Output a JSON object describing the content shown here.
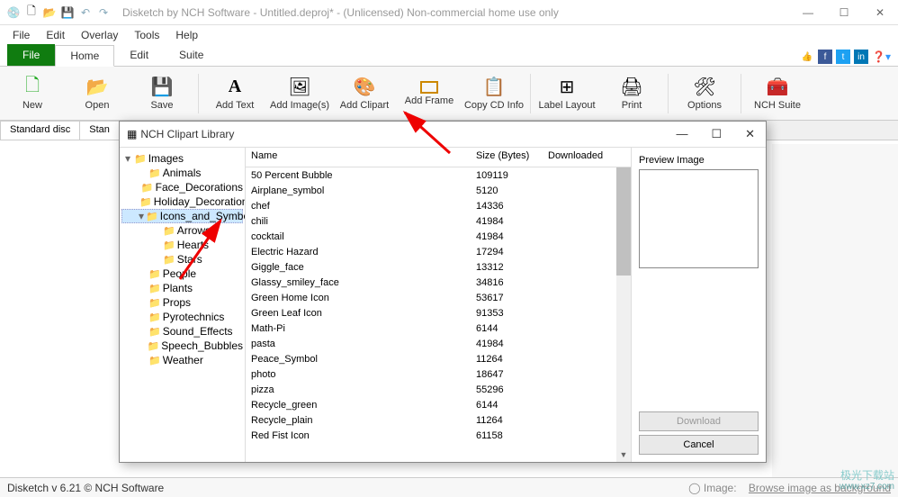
{
  "titlebar": {
    "title": "Disketch by NCH Software - Untitled.deproj* - (Unlicensed) Non-commercial home use only"
  },
  "menubar": [
    "File",
    "Edit",
    "Overlay",
    "Tools",
    "Help"
  ],
  "ribbon": {
    "tabs": [
      "File",
      "Home",
      "Edit",
      "Suite"
    ],
    "active": 1,
    "tools": [
      {
        "label": "New",
        "icon": "🗋"
      },
      {
        "label": "Open",
        "icon": "📂"
      },
      {
        "label": "Save",
        "icon": "💾"
      },
      {
        "label": "Add Text",
        "icon": "A"
      },
      {
        "label": "Add Image(s)",
        "icon": "🖼"
      },
      {
        "label": "Add Clipart",
        "icon": "🎨"
      },
      {
        "label": "Add Frame",
        "icon": "▭"
      },
      {
        "label": "Copy CD Info",
        "icon": "📋"
      },
      {
        "label": "Label Layout",
        "icon": "⊞"
      },
      {
        "label": "Print",
        "icon": "🖨"
      },
      {
        "label": "Options",
        "icon": "🛠"
      },
      {
        "label": "NCH Suite",
        "icon": "🧰"
      }
    ]
  },
  "sectabs": [
    "Standard disc",
    "Stan"
  ],
  "dialog": {
    "title": "NCH Clipart Library",
    "tree": [
      {
        "label": "Images",
        "indent": 0,
        "exp": "▾"
      },
      {
        "label": "Animals",
        "indent": 1
      },
      {
        "label": "Face_Decorations",
        "indent": 1
      },
      {
        "label": "Holiday_Decorations",
        "indent": 1
      },
      {
        "label": "Icons_and_Symbols",
        "indent": 1,
        "selected": true,
        "exp": "▾"
      },
      {
        "label": "Arrows",
        "indent": 2
      },
      {
        "label": "Hearts",
        "indent": 2
      },
      {
        "label": "Stars",
        "indent": 2
      },
      {
        "label": "People",
        "indent": 1
      },
      {
        "label": "Plants",
        "indent": 1
      },
      {
        "label": "Props",
        "indent": 1
      },
      {
        "label": "Pyrotechnics",
        "indent": 1
      },
      {
        "label": "Sound_Effects",
        "indent": 1
      },
      {
        "label": "Speech_Bubbles",
        "indent": 1
      },
      {
        "label": "Weather",
        "indent": 1
      }
    ],
    "columns": [
      "Name",
      "Size (Bytes)",
      "Downloaded"
    ],
    "rows": [
      {
        "name": "50 Percent Bubble",
        "size": "109119"
      },
      {
        "name": "Airplane_symbol",
        "size": "5120"
      },
      {
        "name": "chef",
        "size": "14336"
      },
      {
        "name": "chili",
        "size": "41984"
      },
      {
        "name": "cocktail",
        "size": "41984"
      },
      {
        "name": "Electric Hazard",
        "size": "17294"
      },
      {
        "name": "Giggle_face",
        "size": "13312"
      },
      {
        "name": "Glassy_smiley_face",
        "size": "34816"
      },
      {
        "name": "Green Home Icon",
        "size": "53617"
      },
      {
        "name": "Green Leaf Icon",
        "size": "91353"
      },
      {
        "name": "Math-Pi",
        "size": "6144"
      },
      {
        "name": "pasta",
        "size": "41984"
      },
      {
        "name": "Peace_Symbol",
        "size": "11264"
      },
      {
        "name": "photo",
        "size": "18647"
      },
      {
        "name": "pizza",
        "size": "55296"
      },
      {
        "name": "Recycle_green",
        "size": "6144"
      },
      {
        "name": "Recycle_plain",
        "size": "11264"
      },
      {
        "name": "Red Fist Icon",
        "size": "61158"
      }
    ],
    "preview_label": "Preview Image",
    "buttons": {
      "download": "Download",
      "cancel": "Cancel"
    }
  },
  "footer": {
    "left": "Disketch v 6.21 © NCH Software",
    "image_label": "Image:",
    "browse": "Browse image as background"
  },
  "watermark": {
    "l1": "极光下载站",
    "l2": "www.xz7.com"
  }
}
